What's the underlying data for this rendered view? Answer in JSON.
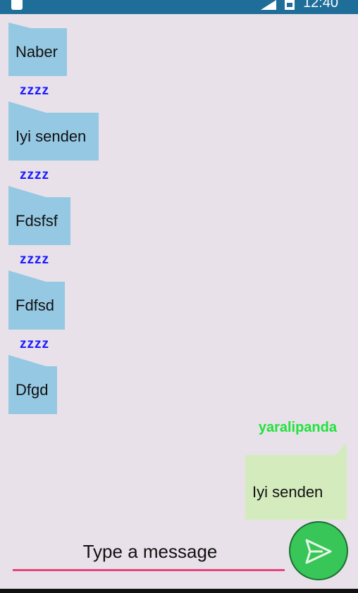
{
  "status_bar": {
    "time": "12:40"
  },
  "messages": [
    {
      "text": "Naber",
      "sender": "zzzz"
    },
    {
      "text": "Iyi senden",
      "sender": "zzzz"
    },
    {
      "text": "Fdsfsf",
      "sender": "zzzz"
    },
    {
      "text": "Fdfsd",
      "sender": "zzzz"
    },
    {
      "text": "Dfgd"
    }
  ],
  "my_message": {
    "sender": "yaralipanda",
    "text": "Iyi senden"
  },
  "composer": {
    "placeholder": "Type a message"
  },
  "colors": {
    "status_bar": "#1f6e9a",
    "background": "#e9e1e9",
    "incoming_bubble": "#95c8e3",
    "outgoing_bubble": "#d4ecbd",
    "incoming_sender": "#1a1aff",
    "outgoing_sender": "#1fe33b",
    "send_button": "#37c657",
    "input_underline": "#e6457a"
  },
  "icons": {
    "send": "send-icon"
  }
}
